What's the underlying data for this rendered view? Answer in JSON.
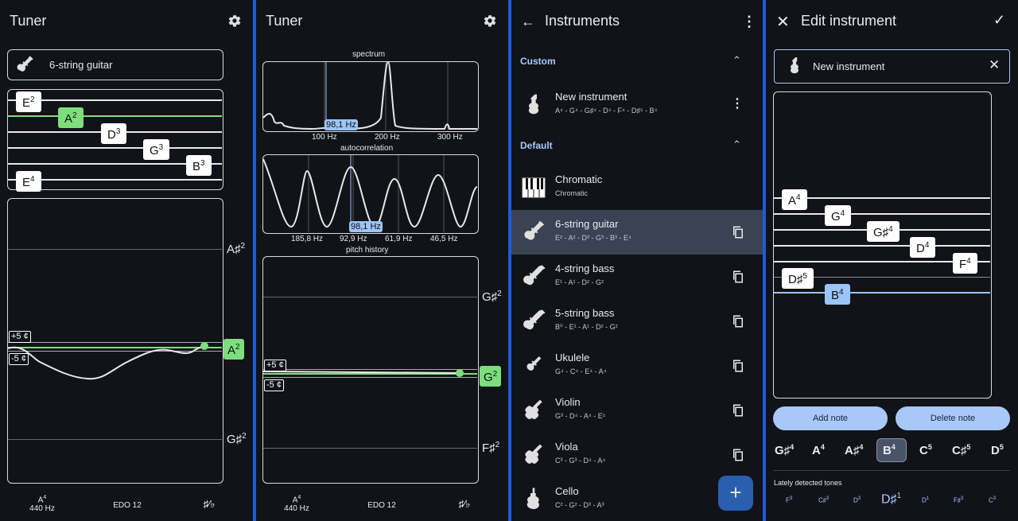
{
  "panel1": {
    "title": "Tuner",
    "instrument": "6-string guitar",
    "strings": [
      "E",
      "A",
      "D",
      "G",
      "B",
      "E"
    ],
    "string_octaves": [
      "2",
      "2",
      "3",
      "3",
      "3",
      "4"
    ],
    "upper_note": "A♯",
    "upper_oct": "2",
    "target_note": "A",
    "target_oct": "2",
    "lower_note": "G♯",
    "lower_oct": "2",
    "plus_cents": "+5 ¢",
    "minus_cents": "-5 ¢",
    "ref_note": "A",
    "ref_oct": "4",
    "ref_freq": "440 Hz",
    "temperament": "EDO 12",
    "accidental_label": "♯⁄♭"
  },
  "panel2": {
    "title": "Tuner",
    "spectrum_label": "spectrum",
    "spectrum_freq": "98,1 Hz",
    "spectrum_ticks": [
      "100 Hz",
      "200 Hz",
      "300 Hz"
    ],
    "autocorr_label": "autocorrelation",
    "autocorr_freq": "98,1 Hz",
    "autocorr_ticks": [
      "185,8 Hz",
      "92,9 Hz",
      "61,9 Hz",
      "46,5 Hz"
    ],
    "history_label": "pitch history",
    "upper_note": "G♯",
    "upper_oct": "2",
    "target_note": "G",
    "target_oct": "2",
    "lower_note": "F♯",
    "lower_oct": "2",
    "plus_cents": "+5 ¢",
    "minus_cents": "-5 ¢",
    "ref_note": "A",
    "ref_oct": "4",
    "ref_freq": "440 Hz",
    "temperament": "EDO 12",
    "accidental_label": "♯⁄♭"
  },
  "panel3": {
    "title": "Instruments",
    "custom_label": "Custom",
    "default_label": "Default",
    "custom_items": [
      {
        "name": "New instrument",
        "tones": "A⁴ - G⁴ - G♯⁴ - D⁴ - F⁴ - D♯⁵ - B⁴"
      }
    ],
    "default_items": [
      {
        "name": "Chromatic",
        "tones": "Chromatic"
      },
      {
        "name": "6-string guitar",
        "tones": "E² - A² - D³ - G³ - B³ - E⁴"
      },
      {
        "name": "4-string bass",
        "tones": "E¹ - A¹ - D² - G²"
      },
      {
        "name": "5-string bass",
        "tones": "B⁰ - E¹ - A¹ - D² - G²"
      },
      {
        "name": "Ukulele",
        "tones": "G⁴ - C⁴ - E⁴ - A⁴"
      },
      {
        "name": "Violin",
        "tones": "G³ - D⁴ - A⁴ - E⁵"
      },
      {
        "name": "Viola",
        "tones": "C³ - G³ - D⁴ - A⁴"
      },
      {
        "name": "Cello",
        "tones": "C² - G² - D³ - A³"
      }
    ],
    "fab_label": "+"
  },
  "panel4": {
    "title": "Edit instrument",
    "instrument_name": "New instrument",
    "notes": [
      {
        "n": "A",
        "o": "4"
      },
      {
        "n": "G",
        "o": "4"
      },
      {
        "n": "G♯",
        "o": "4"
      },
      {
        "n": "D",
        "o": "4"
      },
      {
        "n": "F",
        "o": "4"
      },
      {
        "n": "D♯",
        "o": "5"
      },
      {
        "n": "B",
        "o": "4"
      }
    ],
    "add_note": "Add note",
    "delete_note": "Delete note",
    "tone_picker": [
      {
        "n": "G♯",
        "o": "4"
      },
      {
        "n": "A",
        "o": "4"
      },
      {
        "n": "A♯",
        "o": "4"
      },
      {
        "n": "B",
        "o": "4"
      },
      {
        "n": "C",
        "o": "5"
      },
      {
        "n": "C♯",
        "o": "5"
      },
      {
        "n": "D",
        "o": "5"
      }
    ],
    "recent_label": "Lately detected tones",
    "recent_tones": [
      {
        "n": "F",
        "o": "3"
      },
      {
        "n": "C♯",
        "o": "3"
      },
      {
        "n": "D",
        "o": "3"
      },
      {
        "n": "D♯",
        "o": "1"
      },
      {
        "n": "D",
        "o": "1"
      },
      {
        "n": "F♯",
        "o": "3"
      },
      {
        "n": "C",
        "o": "3"
      }
    ]
  },
  "colors": {
    "background": "#111318",
    "accent_green": "#7dde7d",
    "accent_blue": "#9cc4f7",
    "divider": "#1f5bd6",
    "selected_row": "#3b4253"
  }
}
